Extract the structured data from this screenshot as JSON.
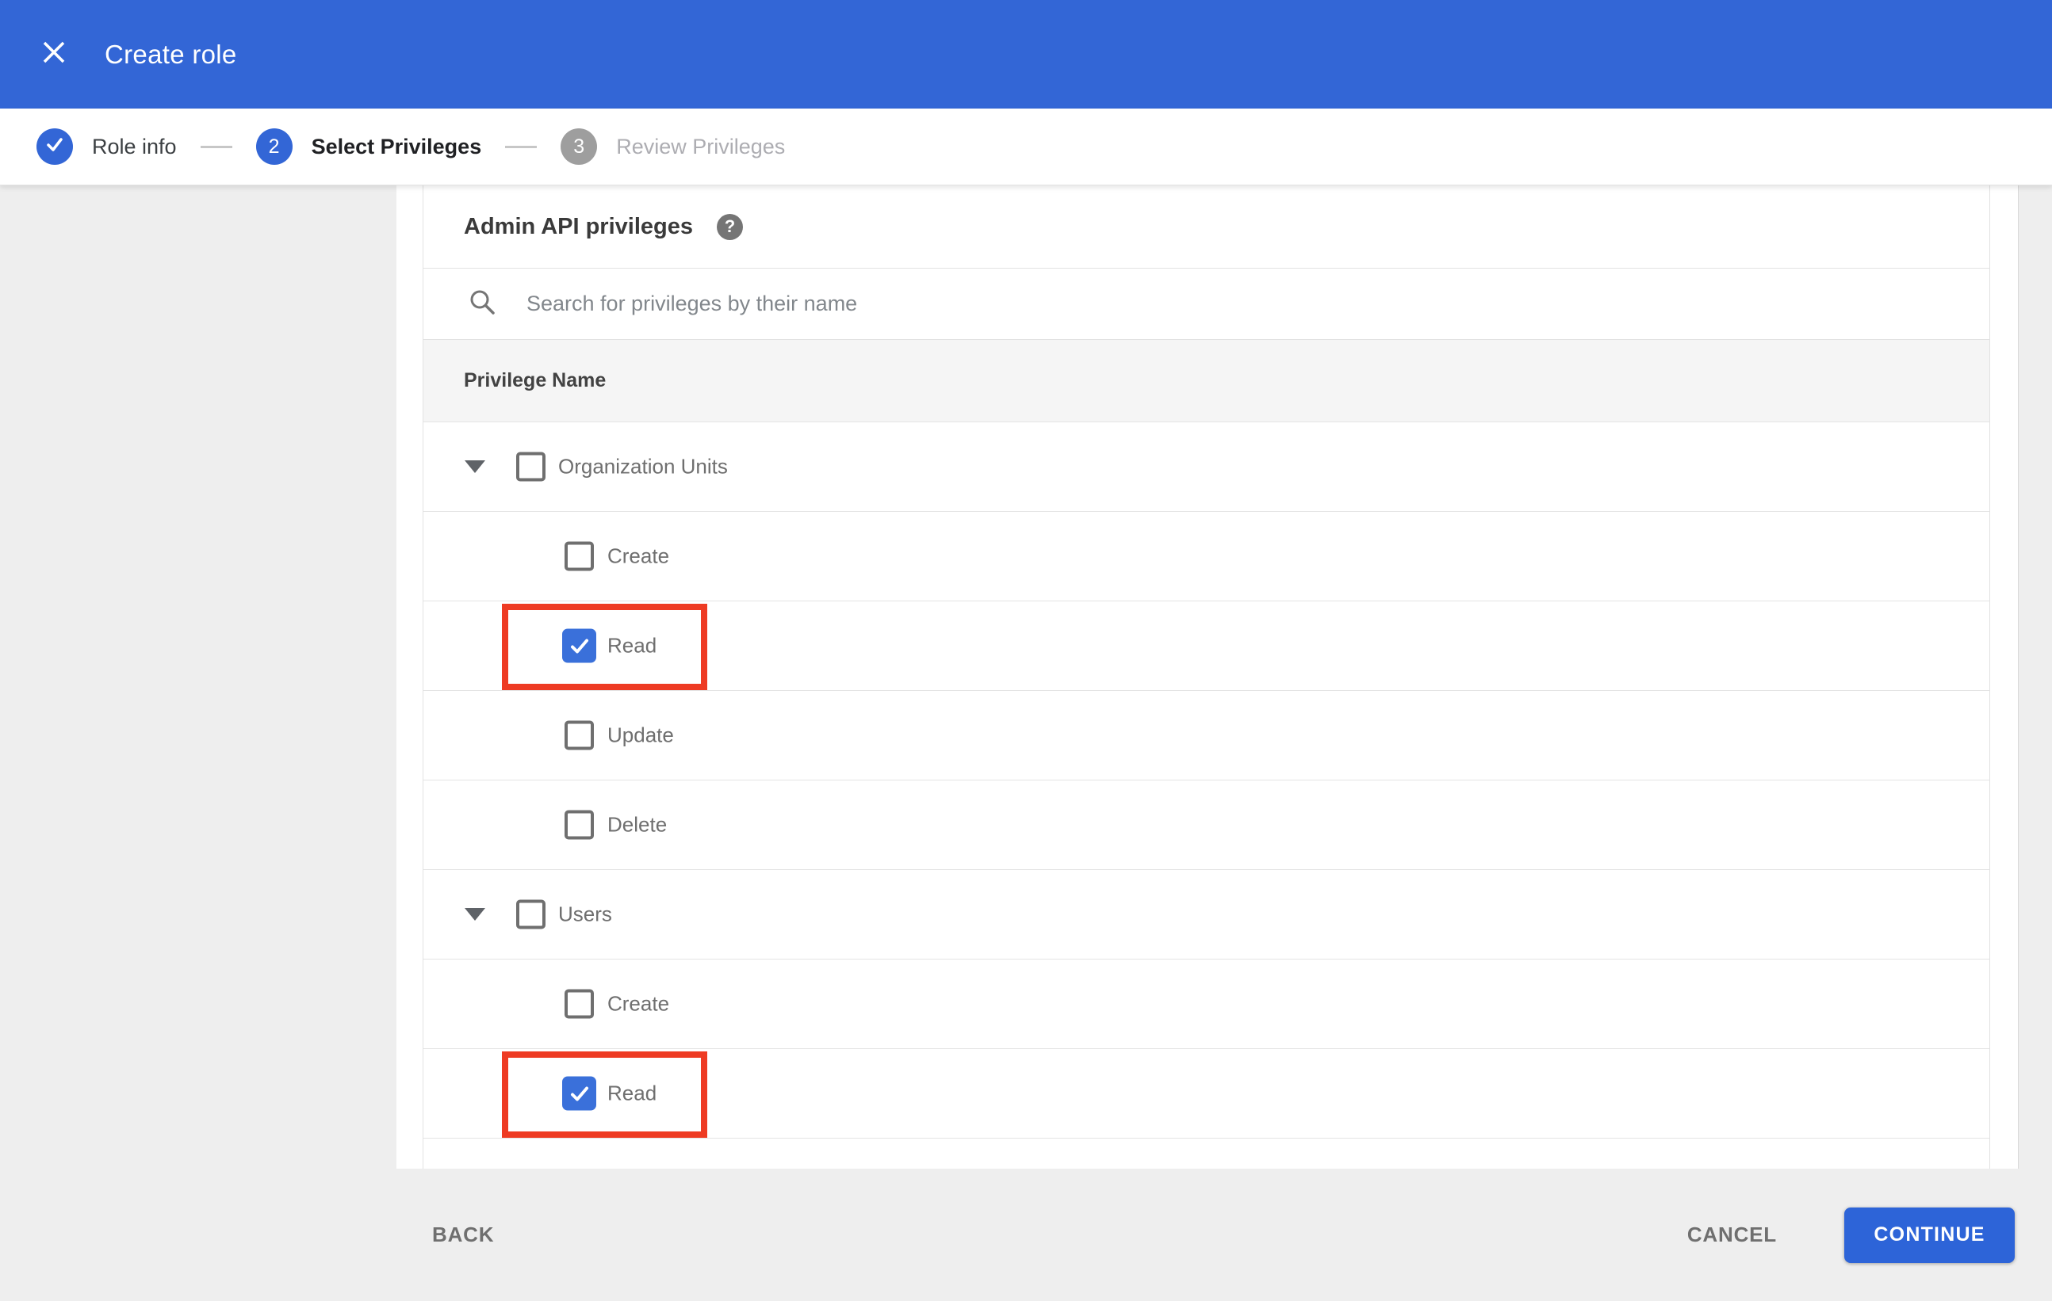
{
  "colors": {
    "header_blue": "#3366d6",
    "accent_blue": "#3366d6",
    "checkbox_blue": "#3a70da",
    "continue_blue": "#2d64d8",
    "highlight_red": "#ee3b23",
    "inactive_step_gray": "#9e9e9e"
  },
  "appbar": {
    "title": "Create role"
  },
  "stepper": {
    "steps": [
      {
        "number": "1",
        "label": "Role info",
        "state": "complete"
      },
      {
        "number": "2",
        "label": "Select Privileges",
        "state": "active"
      },
      {
        "number": "3",
        "label": "Review Privileges",
        "state": "upcoming"
      }
    ]
  },
  "panel": {
    "heading": "Admin API privileges",
    "help_icon": "?",
    "search": {
      "placeholder": "Search for privileges by their name",
      "value": ""
    },
    "table": {
      "header": "Privilege Name",
      "rows": [
        {
          "type": "group",
          "label": "Organization Units",
          "checked": false,
          "expanded": true,
          "highlighted": false
        },
        {
          "type": "child",
          "label": "Create",
          "checked": false,
          "highlighted": false
        },
        {
          "type": "child",
          "label": "Read",
          "checked": true,
          "highlighted": true
        },
        {
          "type": "child",
          "label": "Update",
          "checked": false,
          "highlighted": false
        },
        {
          "type": "child",
          "label": "Delete",
          "checked": false,
          "highlighted": false
        },
        {
          "type": "group",
          "label": "Users",
          "checked": false,
          "expanded": true,
          "highlighted": false
        },
        {
          "type": "child",
          "label": "Create",
          "checked": false,
          "highlighted": false
        },
        {
          "type": "child",
          "label": "Read",
          "checked": true,
          "highlighted": true
        }
      ]
    }
  },
  "footer": {
    "back_label": "BACK",
    "cancel_label": "CANCEL",
    "continue_label": "CONTINUE"
  }
}
